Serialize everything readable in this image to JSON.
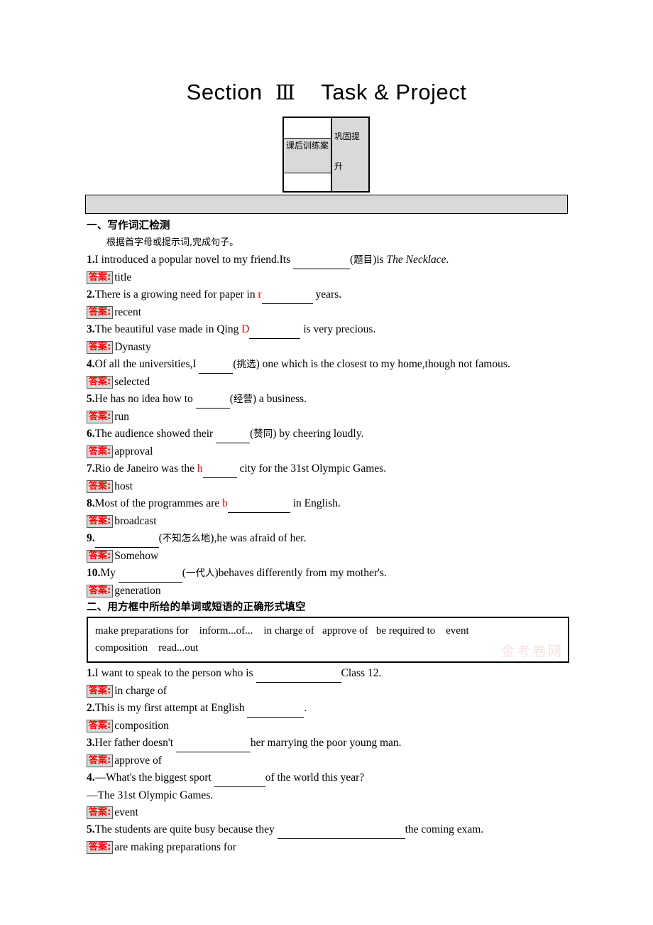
{
  "page": {
    "title_prefix": "Section",
    "title_roman": "Ⅲ",
    "title_suffix": "Task & Project",
    "header_box": {
      "left_label": "课后训练案",
      "right_label": "巩固提升"
    }
  },
  "colors": {
    "hint_red": "#ff0000",
    "answer_tag_bg": "#d9d9d9",
    "banner_gray": "#d9d9d9"
  },
  "section1": {
    "heading": "一、写作词汇检测",
    "instruction": "根据首字母或提示词,完成句子。",
    "answer_label": "答案:",
    "items": [
      {
        "num": "1.",
        "pre": "I introduced a popular novel to my friend.Its ",
        "hint": "",
        "blank_w": 80,
        "post": "(题目)is ",
        "italic": "The Necklace",
        "tail": ".",
        "answer": "title"
      },
      {
        "num": "2.",
        "pre": "There is a growing need for paper in ",
        "hint": "r",
        "blank_w": 72,
        "post": " years.",
        "italic": "",
        "tail": "",
        "answer": "recent"
      },
      {
        "num": "3.",
        "pre": "The beautiful vase made in Qing ",
        "hint": "D",
        "blank_w": 72,
        "post": " is very precious.",
        "italic": "",
        "tail": "",
        "answer": "Dynasty"
      },
      {
        "num": "4.",
        "pre": "Of all the universities,I ",
        "hint": "",
        "blank_w": 48,
        "post": "(挑选) one which is the closest to my home,though not famous.",
        "italic": "",
        "tail": "",
        "answer": "selected"
      },
      {
        "num": "5.",
        "pre": "He has no idea how to ",
        "hint": "",
        "blank_w": 48,
        "post": "(经营) a business.",
        "italic": "",
        "tail": "",
        "answer": "run"
      },
      {
        "num": "6.",
        "pre": "The audience showed their ",
        "hint": "",
        "blank_w": 48,
        "post": "(赞同) by cheering loudly.",
        "italic": "",
        "tail": "",
        "answer": "approval"
      },
      {
        "num": "7.",
        "pre": "Rio de Janeiro was the ",
        "hint": "h",
        "blank_w": 48,
        "post": " city for the 31st Olympic Games.",
        "italic": "",
        "tail": "",
        "answer": "host"
      },
      {
        "num": "8.",
        "pre": "Most of the programmes are ",
        "hint": "b",
        "blank_w": 88,
        "post": " in English.",
        "italic": "",
        "tail": "",
        "answer": "broadcast"
      },
      {
        "num": "9.",
        "pre": "",
        "hint": "",
        "blank_w": 90,
        "post": "(不知怎么地),he was afraid of her.",
        "italic": "",
        "tail": "",
        "answer": "Somehow"
      },
      {
        "num": "10.",
        "pre": "My ",
        "hint": "",
        "blank_w": 90,
        "post": "(一代人)behaves differently from my mother's.",
        "italic": "",
        "tail": "",
        "answer": "generation"
      }
    ]
  },
  "section2": {
    "heading": "二、用方框中所给的单词或短语的正确形式填空",
    "answer_label": "答案:",
    "word_bank": {
      "line1": "make preparations for    inform...of...    in charge of   approve of   be required to    event",
      "line2": "composition    read...out",
      "watermark": "金考卷网"
    },
    "items": [
      {
        "num": "1.",
        "pre": "I want to speak to the person who is ",
        "blank_w": 120,
        "post": "Class 12.",
        "answer": "in charge of",
        "extra": ""
      },
      {
        "num": "2.",
        "pre": "This is my first attempt at English ",
        "blank_w": 80,
        "post": ".",
        "answer": "composition",
        "extra": ""
      },
      {
        "num": "3.",
        "pre": "Her father doesn't ",
        "blank_w": 105,
        "post": "her marrying the poor young man.",
        "answer": "approve of",
        "extra": ""
      },
      {
        "num": "4.",
        "pre": "—What's the biggest sport ",
        "blank_w": 72,
        "post": "of the world this year?",
        "answer": "event",
        "extra": "—The 31st Olympic Games."
      },
      {
        "num": "5.",
        "pre": "The students are quite busy because they ",
        "blank_w": 180,
        "post": "the coming exam.",
        "answer": "are making preparations for",
        "extra": ""
      }
    ]
  }
}
